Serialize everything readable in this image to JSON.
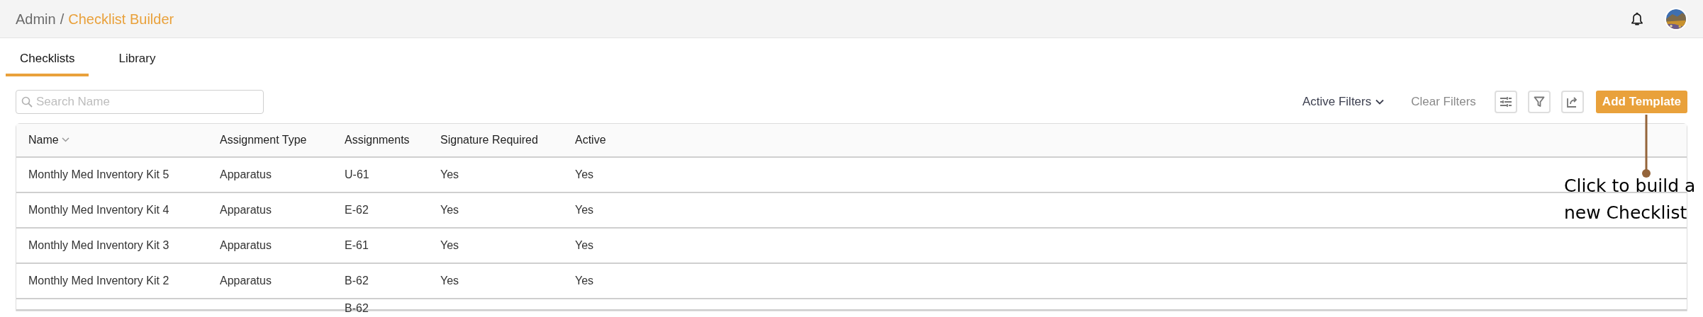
{
  "breadcrumb": {
    "parent": "Admin",
    "separator": "/",
    "current": "Checklist Builder"
  },
  "tabs": [
    {
      "label": "Checklists",
      "selected": true
    },
    {
      "label": "Library",
      "selected": false
    }
  ],
  "search": {
    "placeholder": "Search Name"
  },
  "toolbar": {
    "active_filters": "Active Filters",
    "clear_filters": "Clear Filters",
    "add_button": "Add Template"
  },
  "table": {
    "columns": [
      {
        "label": "Name",
        "sorted": true
      },
      {
        "label": "Assignment Type",
        "sorted": false
      },
      {
        "label": "Assignments",
        "sorted": false
      },
      {
        "label": "Signature Required",
        "sorted": false
      },
      {
        "label": "Active",
        "sorted": false
      }
    ],
    "rows": [
      [
        "Monthly Med Inventory Kit 5",
        "Apparatus",
        "U-61",
        "Yes",
        "Yes"
      ],
      [
        "Monthly Med Inventory Kit 4",
        "Apparatus",
        "E-62",
        "Yes",
        "Yes"
      ],
      [
        "Monthly Med Inventory Kit 3",
        "Apparatus",
        "E-61",
        "Yes",
        "Yes"
      ],
      [
        "Monthly Med Inventory Kit 2",
        "Apparatus",
        "B-62",
        "Yes",
        "Yes"
      ],
      [
        "",
        "",
        "B-62",
        "",
        ""
      ]
    ]
  },
  "callout": {
    "lines": [
      "Click to build a",
      "new Checklist"
    ]
  }
}
